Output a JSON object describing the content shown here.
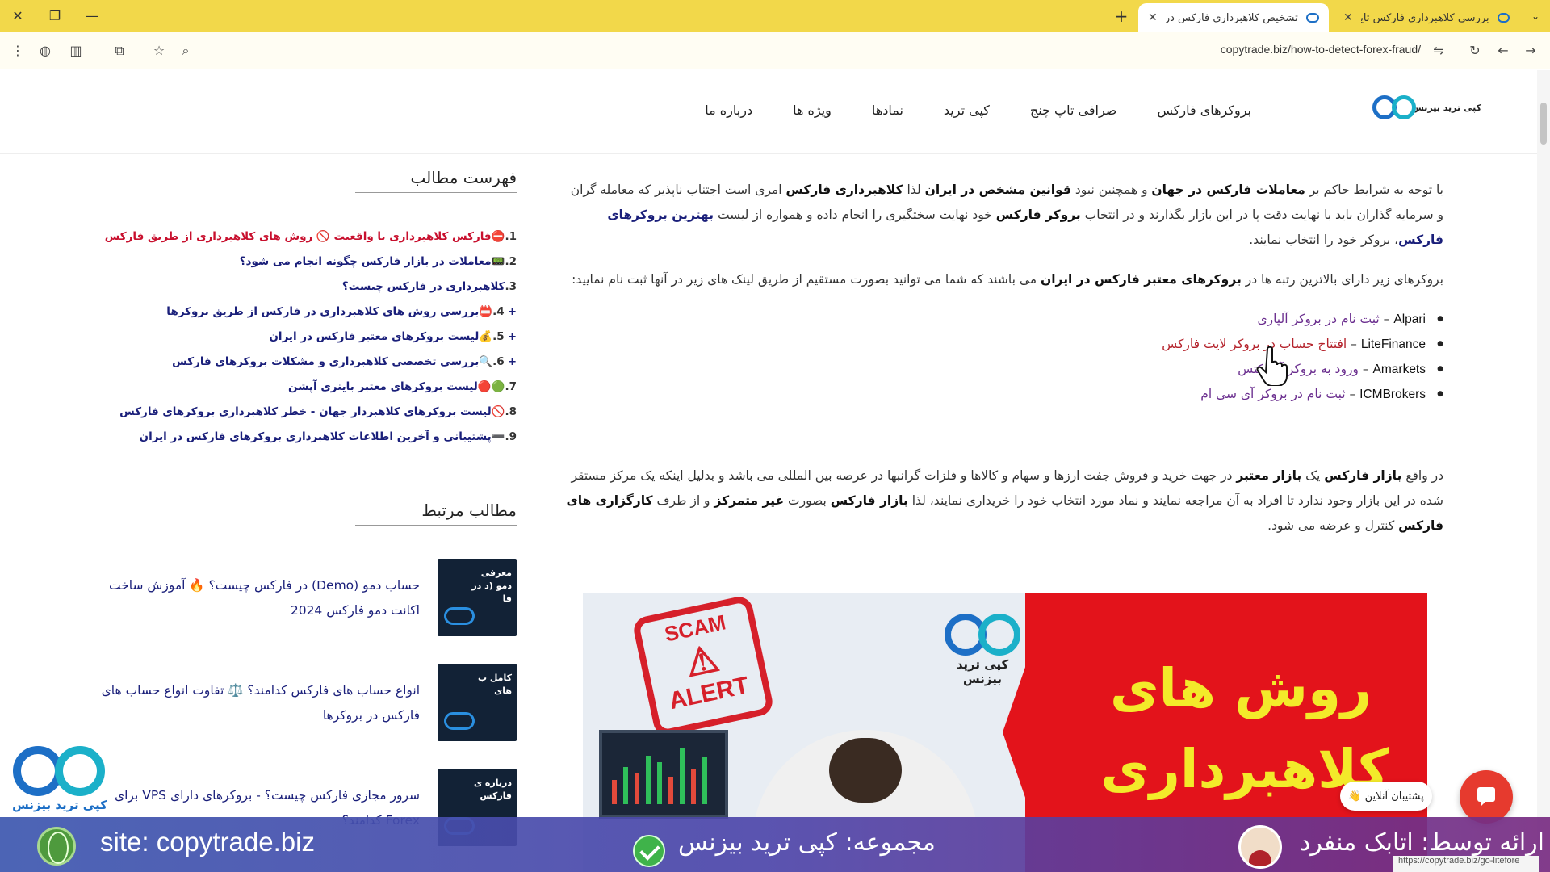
{
  "browser": {
    "tabs": [
      {
        "title": "بررسی کلاهبرداری فارکس تایم (FM"
      },
      {
        "title": "تشخیص کلاهبرداری فارکس در ایرا"
      }
    ],
    "url": "copytrade.biz/how-to-detect-forex-fraud/",
    "status_url": "https://copytrade.biz/go-litefore"
  },
  "site": {
    "logo_text": "کپی ترید بیزنس",
    "nav": [
      "بروکرهای فارکس",
      "صرافی تاپ چنج",
      "کپی ترید",
      "نمادها",
      "ویژه ها",
      "درباره ما"
    ]
  },
  "article": {
    "p1": {
      "t1": "با توجه به شرایط حاکم بر ",
      "b1": "معاملات فارکس در جهان",
      "t2": " و همچنین نبود ",
      "b2": "قوانین مشخص در ایران",
      "t3": " لذا ",
      "b3": "کلاهبرداری فارکس",
      "t4": " امری است اجتناب ناپذیر که معامله گران و سرمایه گذاران باید با نهایت دقت پا در این بازار بگذارند و در انتخاب ",
      "b4": "بروکر فارکس",
      "t5": " خود نهایت سختگیری را انجام داده و همواره از لیست ",
      "link": "بهترین بروکرهای فارکس",
      "t6": "، بروکر خود را انتخاب نمایند."
    },
    "p2": {
      "t1": "بروکرهای زیر دارای بالاترین رتبه ها در ",
      "b1": "بروکرهای معتبر فارکس در ایران",
      "t2": " می باشند که شما می توانید بصورت مستقیم از طریق لینک های زیر در آنها ثبت نام نمایید:"
    },
    "brokers": [
      {
        "name": "Alpari",
        "sep": " – ",
        "link": "ثبت نام در بروکر آلپاری"
      },
      {
        "name": "LiteFinance",
        "sep": " – ",
        "link": "افتتاح حساب در بروکر لایت فارکس"
      },
      {
        "name": "Amarkets",
        "sep": " – ",
        "link": "ورود به بروکر آمارکتس"
      },
      {
        "name": "ICMBrokers",
        "sep": " – ",
        "link": "ثبت نام در بروکر آی سی ام"
      }
    ],
    "p3": {
      "t1": "در واقع ",
      "b1": "بازار فارکس",
      "t2": " یک ",
      "b2": "بازار معتبر",
      "t3": " در جهت خرید و فروش جفت ارزها و سهام و کالاها و فلزات گرانبها در عرصه بین المللی می باشد و بدلیل اینکه یک مرکز مستقر شده در این بازار وجود ندارد تا افراد به آن مراجعه نمایند و نماد مورد انتخاب خود را خریداری نمایند، لذا ",
      "b3": "بازار فارکس",
      "t4": " بصورت ",
      "b4": "غیر متمرکز",
      "t5": " و از طرف ",
      "b5": "کارگزاری های فارکس",
      "t6": " کنترل و عرضه می شود."
    },
    "hero": {
      "stamp_top": "SCAM",
      "stamp_bottom": "ALERT",
      "logo_text": "کپی ترید بیزنس",
      "title_line1": "روش های",
      "title_line2": "کلاهبرداری"
    }
  },
  "sidebar": {
    "toc_title": "فهرست مطالب",
    "toc": [
      {
        "num": "1.",
        "text": "⛔فارکس کلاهبرداری یا واقعیت 🚫 روش های کلاهبرداری از طریق فارکس",
        "red": true,
        "plus": false
      },
      {
        "num": "2.",
        "text": "📟معاملات در بازار فارکس چگونه انجام می شود؟",
        "red": false,
        "plus": false
      },
      {
        "num": "3.",
        "text": "کلاهبرداری در فارکس چیست؟",
        "red": false,
        "plus": false
      },
      {
        "num": "4.",
        "text": "📛بررسی روش های کلاهبرداری در فارکس از طریق بروکرها",
        "red": false,
        "plus": true
      },
      {
        "num": "5.",
        "text": "💰لیست بروکرهای معتبر فارکس در ایران",
        "red": false,
        "plus": true
      },
      {
        "num": "6.",
        "text": "🔍بررسی تخصصی کلاهبرداری و مشکلات بروکرهای فارکس",
        "red": false,
        "plus": true
      },
      {
        "num": "7.",
        "text": "🟢🔴لیست بروکرهای معتبر باینری آپشن",
        "red": false,
        "plus": false
      },
      {
        "num": "8.",
        "text": "🚫لیست بروکرهای کلاهبردار جهان - خطر کلاهبرداری بروکرهای فارکس",
        "red": false,
        "plus": false
      },
      {
        "num": "9.",
        "text": "➖پشتیبانی و آخرین اطلاعات کلاهبرداری بروکرهای فارکس در ایران",
        "red": false,
        "plus": false
      }
    ],
    "related_title": "مطالب مرتبط",
    "related": [
      {
        "title": "حساب دمو (Demo) در فارکس چیست؟ 🔥 آموزش ساخت اکانت دمو فارکس 2024",
        "thumb_text": "معرفی دمو (د در فا"
      },
      {
        "title": "انواع حساب های فارکس کدامند؟ ⚖️ تفاوت انواع حساب های فارکس در بروکرها",
        "thumb_text": "کامل ب های"
      },
      {
        "title": "سرور مجازی فارکس چیست؟ - بروکرهای دارای VPS برای Forex کدامند؟",
        "thumb_text": "درباره ی فارکس"
      }
    ]
  },
  "widgets": {
    "float_logo_text": "کپی ترید بیزنس",
    "support_label": "پشتیبان آنلاین 👋"
  },
  "banner": {
    "site": "site: copytrade.biz",
    "group": "مجموعه: کپی ترید بیزنس",
    "presenter": "ارائه توسط: اتابک منفرد"
  }
}
